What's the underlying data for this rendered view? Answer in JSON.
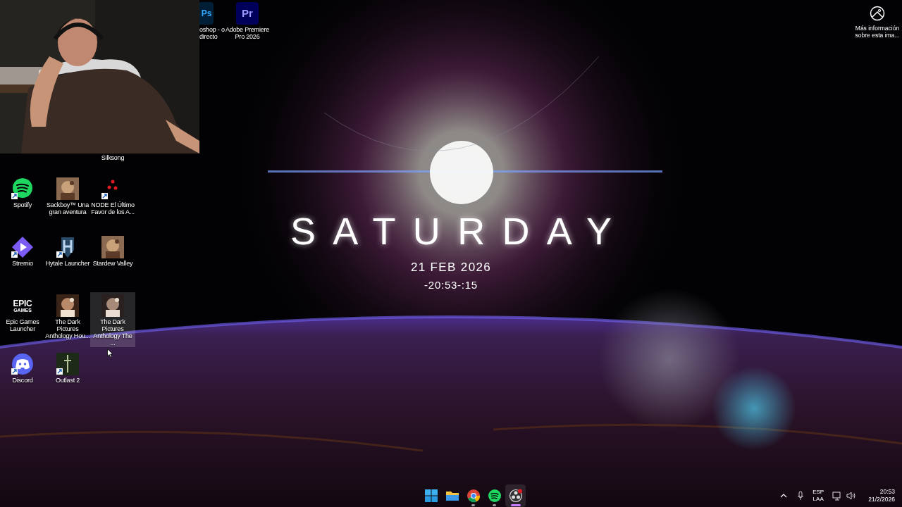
{
  "desktop_icons": [
    {
      "kind": "photoshop",
      "glyph": "Ps",
      "label": "oshop - o directo",
      "partial": true,
      "selected": false
    },
    {
      "kind": "premiere",
      "glyph": "Pr",
      "label": "Adobe Premiere Pro 2026",
      "partial": false,
      "selected": false
    },
    {
      "kind": "covered",
      "label": "Silksong",
      "partial": false,
      "selected": false
    },
    {
      "kind": "spotify",
      "label": "Spotify",
      "partial": false,
      "selected": false
    },
    {
      "kind": "picture",
      "label": "Sackboy™ Una gran aventura",
      "partial": false,
      "selected": false
    },
    {
      "kind": "dots",
      "label": "NODE El Último Favor de los A...",
      "partial": false,
      "selected": false
    },
    {
      "kind": "stremio",
      "label": "Stremio",
      "partial": false,
      "selected": false
    },
    {
      "kind": "shield",
      "label": "Hytale Launcher",
      "partial": false,
      "selected": false
    },
    {
      "kind": "picture",
      "label": "Stardew Valley",
      "partial": false,
      "selected": false
    },
    {
      "kind": "epic",
      "glyph": "EPIC",
      "sub_glyph": "GAMES",
      "label": "Epic Games Launcher",
      "partial": false,
      "selected": false
    },
    {
      "kind": "picture",
      "label": "The Dark Pictures Anthology Hou...",
      "partial": false,
      "selected": false
    },
    {
      "kind": "picture",
      "label": "The Dark Pictures Anthology The ...",
      "partial": false,
      "selected": true
    },
    {
      "kind": "discord",
      "label": "Discord",
      "partial": false,
      "selected": false
    },
    {
      "kind": "dagger",
      "label": "Outlast 2",
      "partial": false,
      "selected": false
    }
  ],
  "image_info": {
    "label": "Más información sobre esta ima..."
  },
  "clock_widget": {
    "day": "SATURDAY",
    "date": "21 FEB 2026",
    "time": "-20:53-:15"
  },
  "taskbar": {
    "apps": [
      {
        "kind": "start",
        "running": false,
        "active": false
      },
      {
        "kind": "folder",
        "running": false,
        "active": false
      },
      {
        "kind": "chrome",
        "running": true,
        "active": false
      },
      {
        "kind": "spotify",
        "running": true,
        "active": false
      },
      {
        "kind": "obs",
        "running": true,
        "active": true
      }
    ],
    "language": "ESP",
    "layout": "LAA",
    "time": "20:53",
    "date": "21/2/2026"
  }
}
